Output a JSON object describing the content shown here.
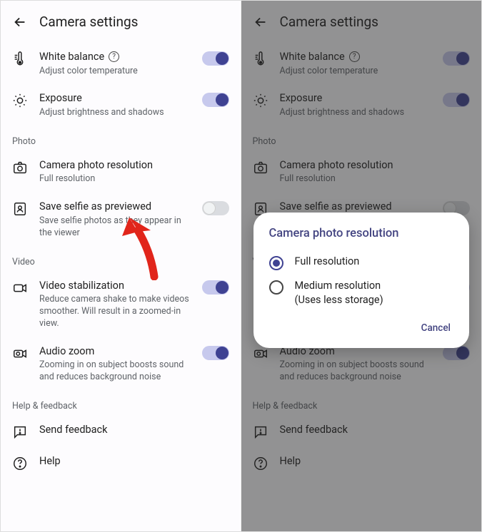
{
  "header": {
    "title": "Camera settings"
  },
  "items": {
    "white_balance": {
      "label": "White balance",
      "sub": "Adjust color temperature",
      "has_help": true,
      "toggle": true
    },
    "exposure": {
      "label": "Exposure",
      "sub": "Adjust brightness and shadows",
      "toggle": true
    },
    "photo_resolution": {
      "label": "Camera photo resolution",
      "sub": "Full resolution"
    },
    "save_selfie": {
      "label": "Save selfie as previewed",
      "sub": "Save selfie photos as they appear in the viewer",
      "toggle": false
    },
    "video_stab": {
      "label": "Video stabilization",
      "sub": "Reduce camera shake to make videos smoother. Will result in a zoomed-in view.",
      "toggle": true
    },
    "audio_zoom": {
      "label": "Audio zoom",
      "sub": "Zooming in on subject boosts sound and reduces background noise",
      "toggle": true
    },
    "send_feedback": {
      "label": "Send feedback"
    },
    "help": {
      "label": "Help"
    }
  },
  "sections": {
    "photo": "Photo",
    "video": "Video",
    "help_feedback": "Help & feedback"
  },
  "dialog": {
    "title": "Camera photo resolution",
    "options": {
      "full": "Full resolution",
      "medium_line1": "Medium resolution",
      "medium_line2": "(Uses less storage)"
    },
    "selected": "full",
    "cancel": "Cancel"
  }
}
